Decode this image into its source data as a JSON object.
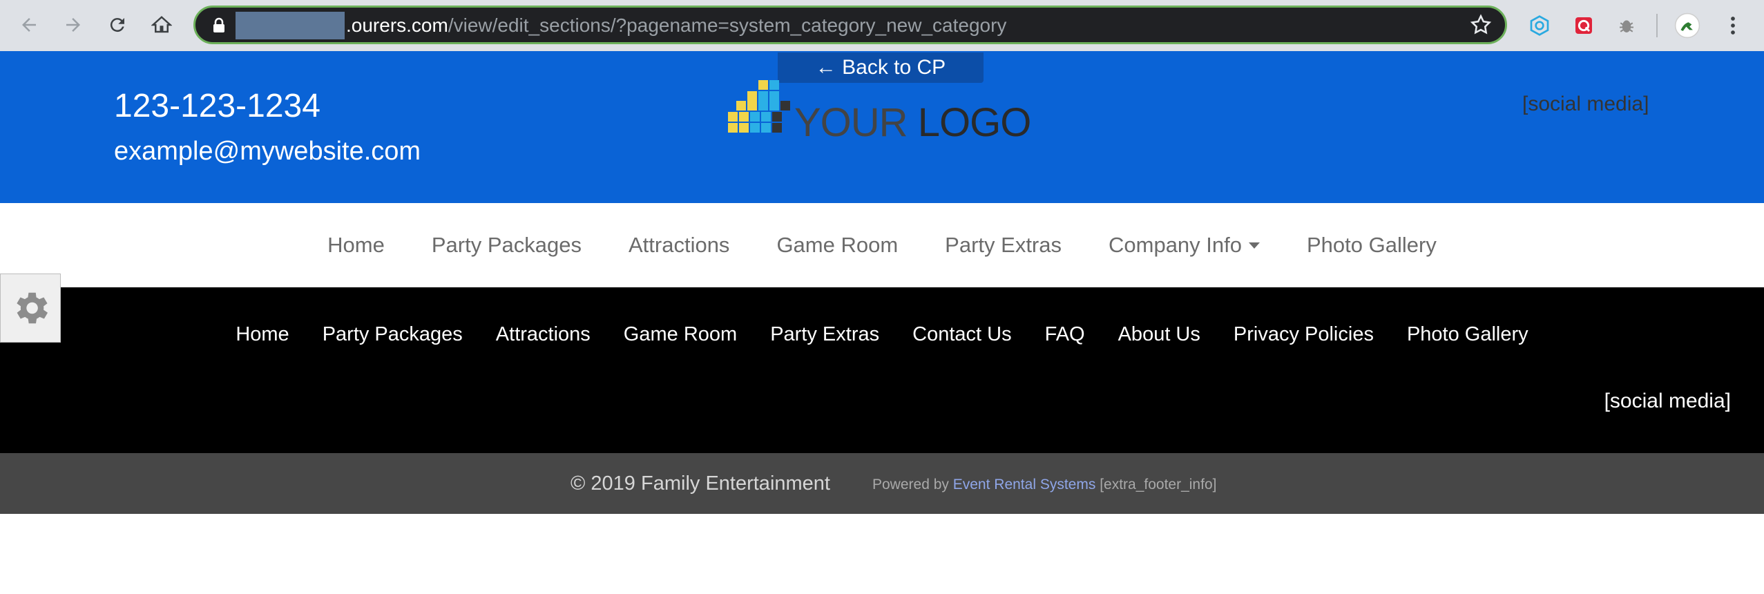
{
  "browser": {
    "url_host": ".ourers.com",
    "url_path": "/view/edit_sections/?pagename=system_category_new_category",
    "icons": [
      "back-arrow-icon",
      "forward-arrow-icon",
      "reload-icon",
      "home-icon",
      "lock-icon",
      "bookmark-star-icon",
      "extension-hex-icon",
      "extension-red-icon",
      "extension-bug-icon",
      "profile-avatar-icon",
      "kebab-menu-icon"
    ]
  },
  "header": {
    "phone": "123-123-1234",
    "email": "example@mywebsite.com",
    "back_label": "← Back to CP",
    "logo_text_your": "YOUR",
    "logo_text_logo": "LOGO",
    "social": "[social media]"
  },
  "primary_nav": {
    "items": [
      "Home",
      "Party Packages",
      "Attractions",
      "Game Room",
      "Party Extras",
      "Company Info",
      "Photo Gallery"
    ]
  },
  "footer_nav": {
    "items": [
      "Home",
      "Party Packages",
      "Attractions",
      "Game Room",
      "Party Extras",
      "Contact Us",
      "FAQ",
      "About Us",
      "Privacy Policies",
      "Photo Gallery"
    ],
    "social": "[social media]"
  },
  "footer_bottom": {
    "copyright": "© 2019 Family Entertainment",
    "powered_by": "Powered by",
    "powered_link": "Event Rental Systems",
    "extra": "[extra_footer_info]"
  },
  "colors": {
    "header_bg": "#0a63d6",
    "footer_bg": "#000000",
    "copybar_bg": "#474747",
    "link": "#8fa6e8"
  }
}
